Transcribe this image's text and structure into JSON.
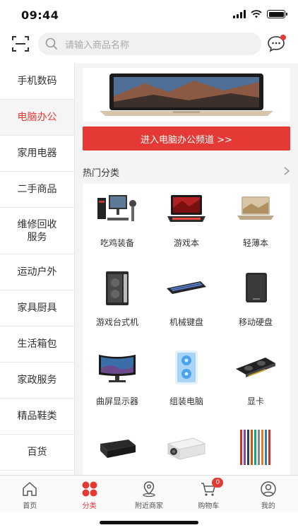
{
  "status_bar": {
    "time": "09:44"
  },
  "search": {
    "placeholder": "请输入商品名称"
  },
  "sidebar": {
    "items": [
      {
        "label": "手机数码",
        "active": false
      },
      {
        "label": "电脑办公",
        "active": true
      },
      {
        "label": "家用电器",
        "active": false
      },
      {
        "label": "二手商品",
        "active": false
      },
      {
        "label": "维修回收服务",
        "active": false
      },
      {
        "label": "运动户外",
        "active": false
      },
      {
        "label": "家具厨具",
        "active": false
      },
      {
        "label": "生活箱包",
        "active": false
      },
      {
        "label": "家政服务",
        "active": false
      },
      {
        "label": "精品鞋类",
        "active": false
      },
      {
        "label": "百货",
        "active": false
      }
    ]
  },
  "content": {
    "channel_button": "进入电脑办公频道 >>",
    "hot_title": "热门分类",
    "hot_items": [
      {
        "label": "吃鸡装备",
        "icon": "gaming-setup-icon"
      },
      {
        "label": "游戏本",
        "icon": "gaming-laptop-icon"
      },
      {
        "label": "轻薄本",
        "icon": "thin-laptop-icon"
      },
      {
        "label": "游戏台式机",
        "icon": "desktop-tower-icon"
      },
      {
        "label": "机械键盘",
        "icon": "keyboard-icon"
      },
      {
        "label": "移动硬盘",
        "icon": "hard-drive-icon"
      },
      {
        "label": "曲屏显示器",
        "icon": "curved-monitor-icon"
      },
      {
        "label": "组装电脑",
        "icon": "pc-case-icon"
      },
      {
        "label": "显卡",
        "icon": "graphics-card-icon"
      },
      {
        "label": "",
        "icon": "printer-icon"
      },
      {
        "label": "",
        "icon": "projector-icon"
      },
      {
        "label": "",
        "icon": "pens-icon"
      }
    ]
  },
  "tab_bar": {
    "tabs": [
      {
        "label": "首页",
        "icon": "home-icon",
        "active": false
      },
      {
        "label": "分类",
        "icon": "category-icon",
        "active": true
      },
      {
        "label": "附近商家",
        "icon": "location-icon",
        "active": false
      },
      {
        "label": "购物车",
        "icon": "cart-icon",
        "active": false,
        "badge": "0"
      },
      {
        "label": "我的",
        "icon": "profile-icon",
        "active": false
      }
    ]
  },
  "colors": {
    "accent": "#e53935",
    "sidebar_active_bg": "#f5f5f5",
    "content_bg": "#f4f4f4"
  }
}
